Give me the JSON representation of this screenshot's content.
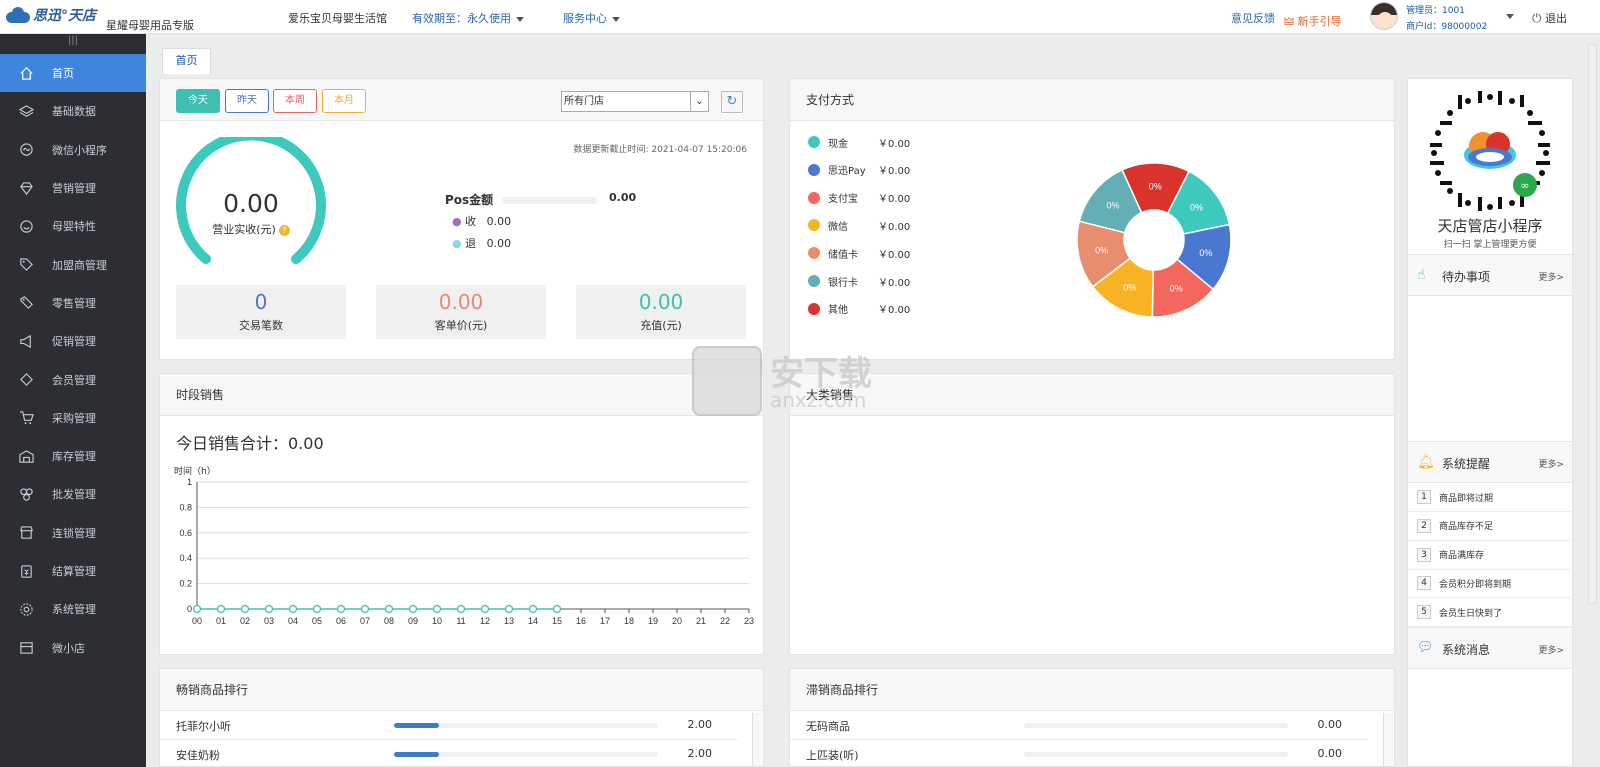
{
  "header": {
    "logo_text": "思迅°天店",
    "brand_sub": "星耀母婴用品专版",
    "store_name": "爱乐宝贝母婴生活馆",
    "validity": "有效期至：永久使用",
    "service_center": "服务中心",
    "feedback": "意见反馈",
    "guide": "新手引导",
    "admin": "管理员：1001",
    "merchant": "商户Id：98000002",
    "logout": "退出"
  },
  "sidebar": {
    "handle": "|||",
    "items": [
      {
        "label": "首页",
        "icon": "home-icon"
      },
      {
        "label": "基础数据",
        "icon": "layers-icon"
      },
      {
        "label": "微信小程序",
        "icon": "miniprogram-icon"
      },
      {
        "label": "营销管理",
        "icon": "diamond-icon"
      },
      {
        "label": "母婴特性",
        "icon": "smile-icon"
      },
      {
        "label": "加盟商管理",
        "icon": "tag-icon"
      },
      {
        "label": "零售管理",
        "icon": "price-tag-icon"
      },
      {
        "label": "促销管理",
        "icon": "megaphone-icon"
      },
      {
        "label": "会员管理",
        "icon": "member-diamond-icon"
      },
      {
        "label": "采购管理",
        "icon": "cart-icon"
      },
      {
        "label": "库存管理",
        "icon": "warehouse-icon"
      },
      {
        "label": "批发管理",
        "icon": "boxes-icon"
      },
      {
        "label": "连锁管理",
        "icon": "store-icon"
      },
      {
        "label": "结算管理",
        "icon": "settle-icon"
      },
      {
        "label": "系统管理",
        "icon": "gear-icon"
      },
      {
        "label": "微小店",
        "icon": "shop-icon"
      }
    ]
  },
  "tabs": {
    "home": "首页"
  },
  "overview": {
    "buttons": {
      "today": "今天",
      "yesterday": "昨天",
      "week": "本周",
      "month": "本月"
    },
    "store_select": "所有门店",
    "update_time": "数据更新截止时间:   2021-04-07 15:20:06",
    "gauge_value": "0.00",
    "gauge_label": "营业实收(元)",
    "pos_label": "Pos金额",
    "pos_value": "0.00",
    "receive_label": "收",
    "receive_value": "0.00",
    "refund_label": "退",
    "refund_value": "0.00",
    "stats": [
      {
        "value": "0",
        "label": "交易笔数",
        "color": "#4a78c5"
      },
      {
        "value": "0.00",
        "label": "客单价(元)",
        "color": "#e58a7a"
      },
      {
        "value": "0.00",
        "label": "充值(元)",
        "color": "#3fbfb1"
      }
    ]
  },
  "payment": {
    "title": "支付方式",
    "items": [
      {
        "name": "现金",
        "amount": "￥0.00",
        "color": "#3ec9bf",
        "pct": "0%"
      },
      {
        "name": "思迅Pay",
        "amount": "￥0.00",
        "color": "#4a78d0",
        "pct": "0%"
      },
      {
        "name": "支付宝",
        "amount": "￥0.00",
        "color": "#f4675f",
        "pct": "0%"
      },
      {
        "name": "微信",
        "amount": "￥0.00",
        "color": "#f8b324",
        "pct": "0%"
      },
      {
        "name": "储值卡",
        "amount": "￥0.00",
        "color": "#e88d6d",
        "pct": "0%"
      },
      {
        "name": "银行卡",
        "amount": "￥0.00",
        "color": "#64aeb5",
        "pct": "0%"
      },
      {
        "name": "其他",
        "amount": "￥0.00",
        "color": "#d9332c",
        "pct": "0%"
      }
    ]
  },
  "hourly": {
    "title": "时段销售",
    "total": "今日销售合计：0.00",
    "axis_label": "时间（h）"
  },
  "chart_data": {
    "type": "line",
    "title": "今日销售合计：0.00",
    "ylabel": "时间（h）",
    "x": [
      "00",
      "01",
      "02",
      "03",
      "04",
      "05",
      "06",
      "07",
      "08",
      "09",
      "10",
      "11",
      "12",
      "13",
      "14",
      "15",
      "16",
      "17",
      "18",
      "19",
      "20",
      "21",
      "22",
      "23"
    ],
    "y_ticks": [
      "0",
      "0.2",
      "0.4",
      "0.6",
      "0.8",
      "1"
    ],
    "ylim": [
      0,
      1
    ],
    "series": [
      {
        "values": [
          0,
          0,
          0,
          0,
          0,
          0,
          0,
          0,
          0,
          0,
          0,
          0,
          0,
          0,
          0,
          0
        ]
      }
    ],
    "color": "#3fbfb1",
    "grid": true
  },
  "category_sales": {
    "title": "大类销售"
  },
  "best_sellers": {
    "title": "畅销商品排行",
    "rows": [
      {
        "name": "托菲尔小听",
        "value": "2.00",
        "fraction": 0.17
      },
      {
        "name": "安佳奶粉",
        "value": "2.00",
        "fraction": 0.17
      }
    ]
  },
  "slow_sellers": {
    "title": "滞销商品排行",
    "rows": [
      {
        "name": "无码商品",
        "value": "0.00",
        "fraction": 0
      },
      {
        "name": "上匹装(听)",
        "value": "0.00",
        "fraction": 0
      }
    ]
  },
  "miniprogram": {
    "title": "天店管店小程序",
    "subtitle": "扫一扫 掌上管理更方便"
  },
  "todo": {
    "title": "待办事项",
    "more": "更多>"
  },
  "reminders": {
    "title": "系统提醒",
    "more": "更多>",
    "items": [
      "商品即将过期",
      "商品库存不足",
      "商品满库存",
      "会员积分即将到期",
      "会员生日快到了"
    ]
  },
  "messages": {
    "title": "系统消息",
    "more": "更多>"
  },
  "watermark": {
    "text": "安下载",
    "url": "anxz.com"
  }
}
